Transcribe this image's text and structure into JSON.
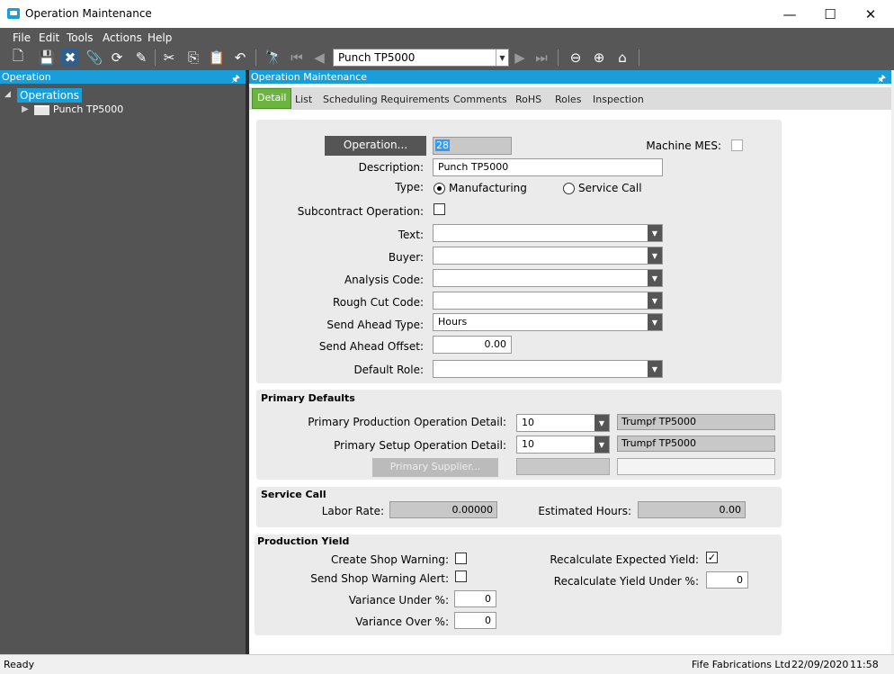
{
  "window": {
    "title": "Operation Maintenance",
    "minimize_glyph": "—",
    "maximize_glyph": "☐",
    "close_glyph": "✕"
  },
  "menu": [
    "File",
    "Edit",
    "Tools",
    "Actions",
    "Help"
  ],
  "toolbar": {
    "nav_value": "Punch TP5000",
    "icons": [
      "new-icon",
      "save-icon",
      "delete-icon",
      "attach-icon",
      "refresh-icon",
      "clear-icon",
      "cut-icon",
      "copy-icon",
      "paste-icon",
      "undo-icon",
      "search-icon",
      "first-icon",
      "prev-icon",
      "next-icon",
      "last-icon",
      "back-icon",
      "forward-icon",
      "home-icon"
    ]
  },
  "left_panel": {
    "title": "Operation",
    "pin": "🖈",
    "tree_root": "Operations",
    "tree_child": "Punch TP5000"
  },
  "right_panel": {
    "title": "Operation Maintenance",
    "pin": "🖈"
  },
  "tabs": [
    "Detail",
    "List",
    "Scheduling Requirements",
    "Comments",
    "RoHS",
    "Roles",
    "Inspection"
  ],
  "detail": {
    "operation_button": "Operation...",
    "operation_value": "28",
    "machine_mes_label": "Machine MES:",
    "description_label": "Description:",
    "description_value": "Punch TP5000",
    "type_label": "Type:",
    "type_option_1": "Manufacturing",
    "type_option_2": "Service Call",
    "subcontract_label": "Subcontract Operation:",
    "text_label": "Text:",
    "buyer_label": "Buyer:",
    "analysis_label": "Analysis Code:",
    "roughcut_label": "Rough Cut Code:",
    "sendahead_type_label": "Send Ahead Type:",
    "sendahead_type_value": "Hours",
    "sendahead_offset_label": "Send Ahead Offset:",
    "sendahead_offset_value": "0.00",
    "default_role_label": "Default Role:"
  },
  "primary_defaults": {
    "header": "Primary Defaults",
    "prod_label": "Primary Production Operation Detail:",
    "prod_value": "10",
    "prod_desc": "Trumpf TP5000",
    "setup_label": "Primary Setup Operation Detail:",
    "setup_value": "10",
    "setup_desc": "Trumpf TP5000",
    "supplier_button": "Primary Supplier..."
  },
  "service_call": {
    "header": "Service Call",
    "labor_label": "Labor Rate:",
    "labor_value": "0.00000",
    "est_label": "Estimated Hours:",
    "est_value": "0.00"
  },
  "production_yield": {
    "header": "Production Yield",
    "create_warning_label": "Create Shop Warning:",
    "send_alert_label": "Send Shop Warning Alert:",
    "var_under_label": "Variance Under %:",
    "var_under_value": "0",
    "var_over_label": "Variance Over %:",
    "var_over_value": "0",
    "recalc_label": "Recalculate Expected Yield:",
    "recalc_check": "✓",
    "recalc_under_label": "Recalculate Yield Under %:",
    "recalc_under_value": "0"
  },
  "status": {
    "left": "Ready",
    "company": "Fife Fabrications Ltd",
    "date": "22/09/2020",
    "time": "11:58"
  }
}
